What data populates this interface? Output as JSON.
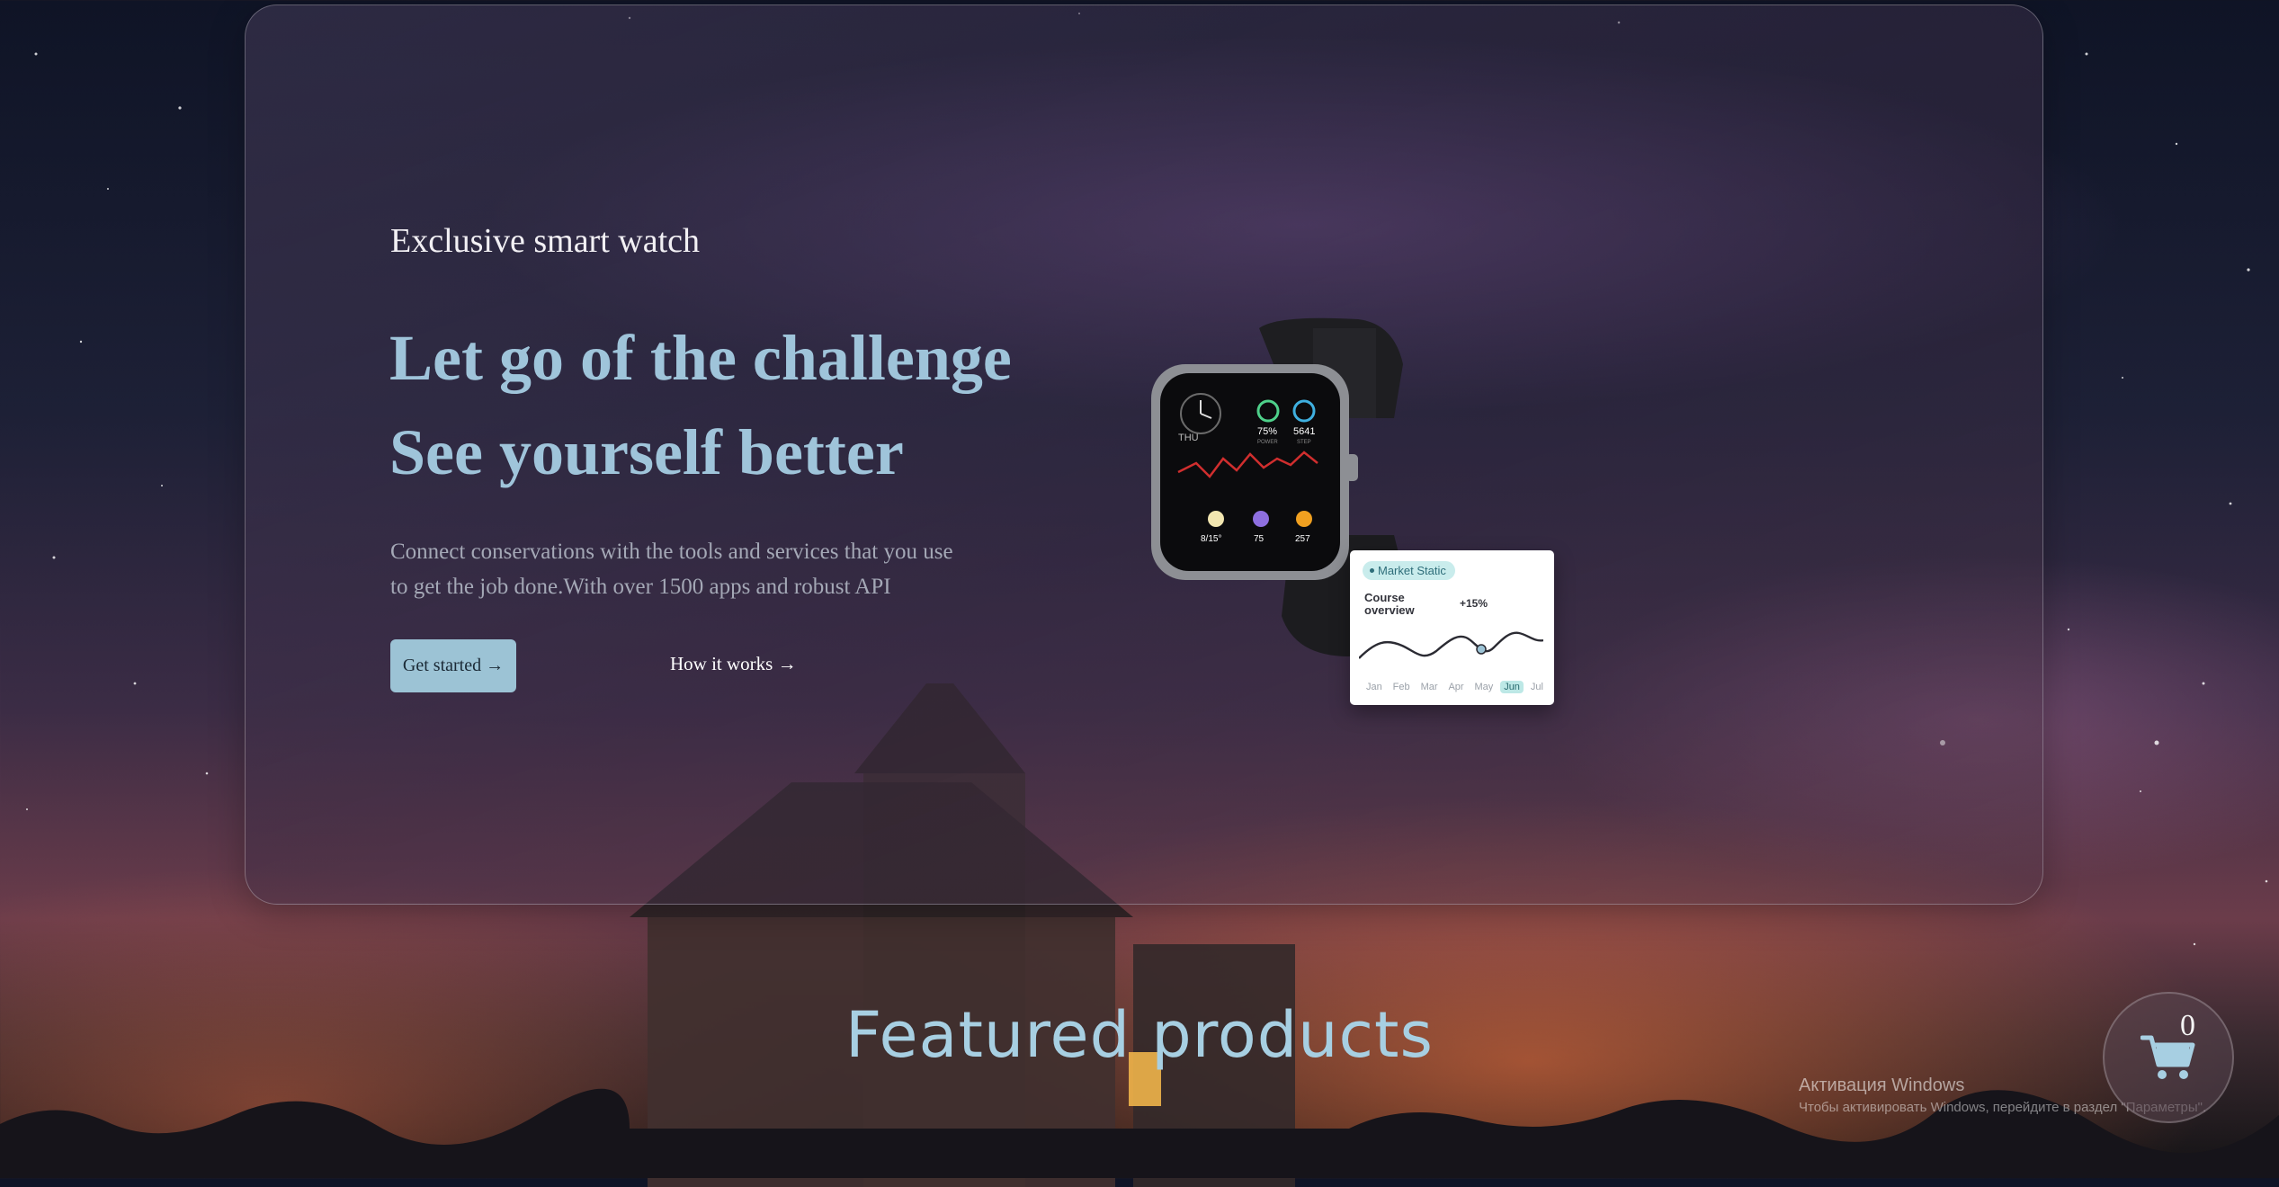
{
  "hero": {
    "eyebrow": "Exclusive smart watch",
    "headline_line1": "Let go of the challenge",
    "headline_line2": "See yourself better",
    "description": "Connect conservations with the tools and services that you use to get the job done.With over 1500 apps and robust API",
    "primary_button": "Get started →",
    "secondary_link": "How it works →"
  },
  "watch_screen": {
    "day": "THU",
    "battery": "75%",
    "steps": "5641",
    "battery_label": "POWER",
    "steps_label": "STEP",
    "weather": "8/15°",
    "heart": "75",
    "calories": "257"
  },
  "stat_card": {
    "badge": "Market Static",
    "title": "Course overview",
    "change": "+15%",
    "months": [
      "Jan",
      "Feb",
      "Mar",
      "Apr",
      "May",
      "Jun",
      "Jul"
    ],
    "active_month": "Jun",
    "line_color": "#2b2b33",
    "accent": "#9cc3d5"
  },
  "featured": {
    "title": "Featured products"
  },
  "cart": {
    "count": "0",
    "icon": "cart-icon"
  },
  "watermark": {
    "title": "Активация Windows",
    "subtitle": "Чтобы активировать Windows, перейдите в раздел \"Параметры\"."
  }
}
